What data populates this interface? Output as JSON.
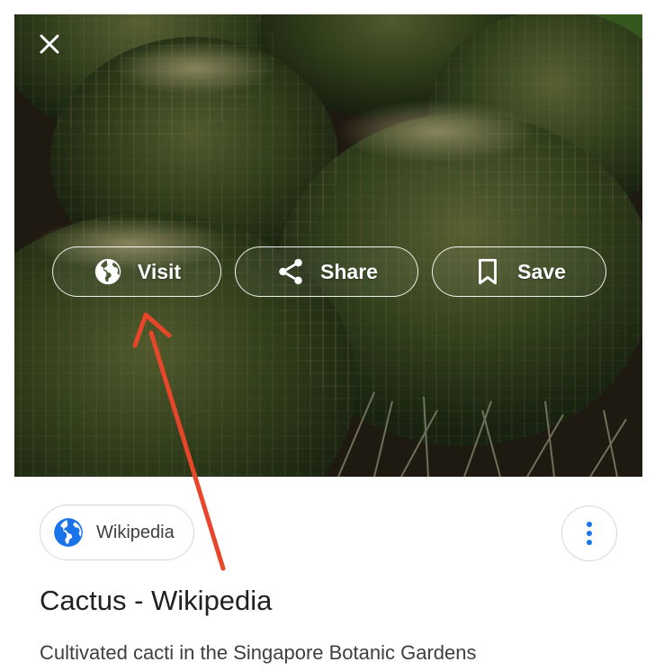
{
  "image_panel": {
    "close_icon": "close-icon",
    "actions": [
      {
        "label": "Visit",
        "icon": "globe-icon"
      },
      {
        "label": "Share",
        "icon": "share-icon"
      },
      {
        "label": "Save",
        "icon": "bookmark-icon"
      }
    ]
  },
  "source": {
    "name": "Wikipedia",
    "icon": "globe-icon",
    "icon_color": "#1a73e8"
  },
  "more_icon": "more-vert-icon",
  "more_icon_color": "#1a73e8",
  "result": {
    "title": "Cactus - Wikipedia",
    "caption": "Cultivated cacti in the Singapore Botanic Gardens"
  },
  "annotation": {
    "arrow_color": "#e8462a",
    "points_to": "Visit"
  }
}
